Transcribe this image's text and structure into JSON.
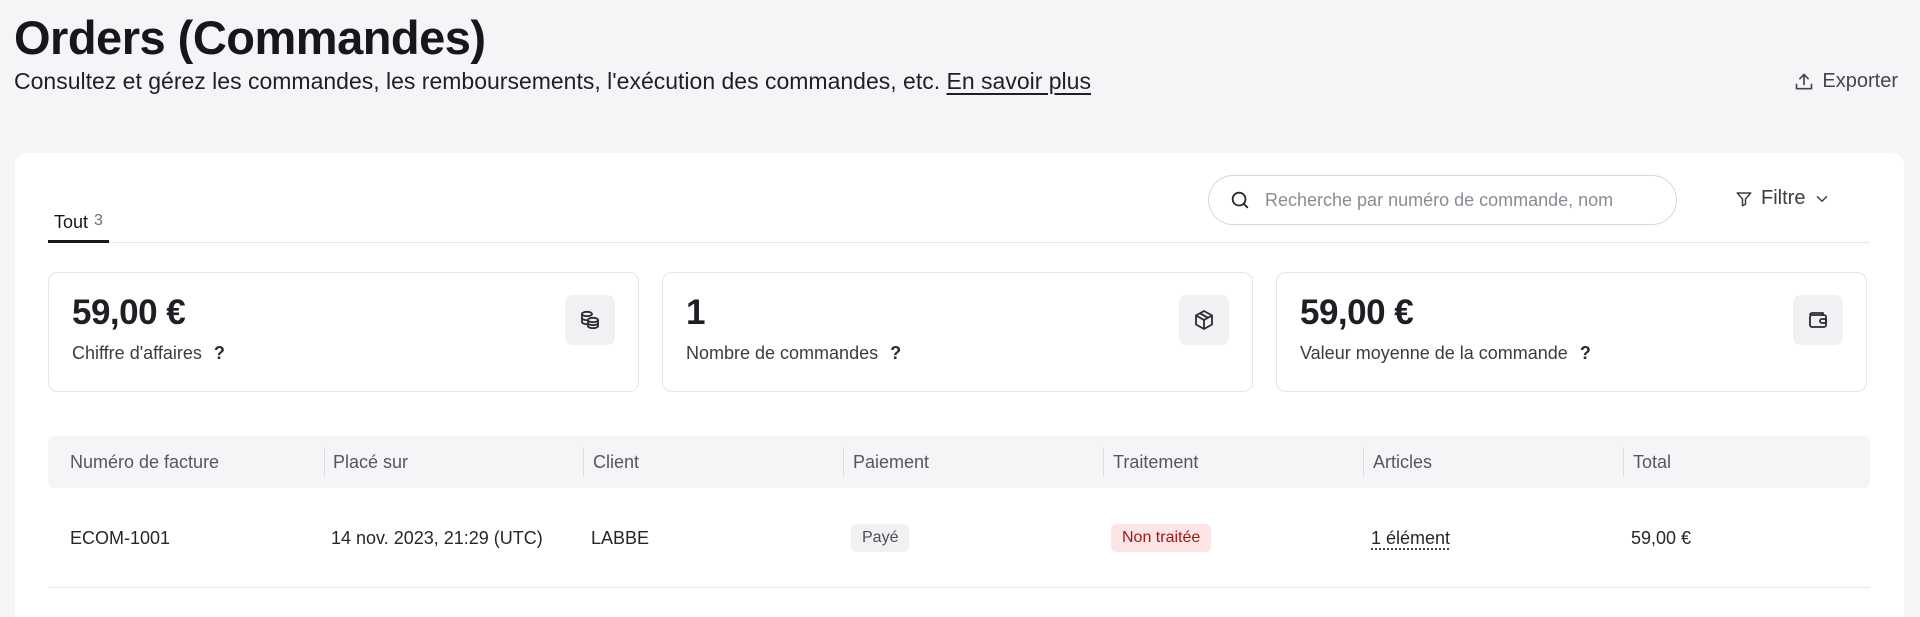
{
  "header": {
    "title": "Orders (Commandes)",
    "subtitle": "Consultez et gérez les commandes, les remboursements, l'exécution des commandes, etc. ",
    "learn_more": "En savoir plus",
    "export_label": "Exporter"
  },
  "tabs": [
    {
      "label": "Tout",
      "count": "3"
    }
  ],
  "search": {
    "placeholder": "Recherche par numéro de commande, nom",
    "value": ""
  },
  "filter": {
    "label": "Filtre"
  },
  "stats": [
    {
      "value": "59,00 €",
      "label": "Chiffre d'affaires",
      "icon": "coins-icon"
    },
    {
      "value": "1",
      "label": "Nombre de commandes",
      "icon": "box-icon"
    },
    {
      "value": "59,00 €",
      "label": "Valeur moyenne de la commande",
      "icon": "wallet-icon"
    }
  ],
  "help_glyph": "?",
  "table": {
    "columns": [
      "Numéro de facture",
      "Placé sur",
      "Client",
      "Paiement",
      "Traitement",
      "Articles",
      "Total"
    ],
    "rows": [
      {
        "invoice": "ECOM-1001",
        "placed_on": "14 nov. 2023, 21:29 (UTC)",
        "client": "LABBE",
        "payment": "Payé",
        "fulfillment": "Non traitée",
        "items": "1 élément",
        "total": "59,00 €"
      }
    ]
  },
  "colors": {
    "background": "#f5f5f7",
    "card": "#ffffff",
    "unfulfilled_badge_bg": "#fde5e5",
    "unfulfilled_badge_text": "#a11919"
  }
}
